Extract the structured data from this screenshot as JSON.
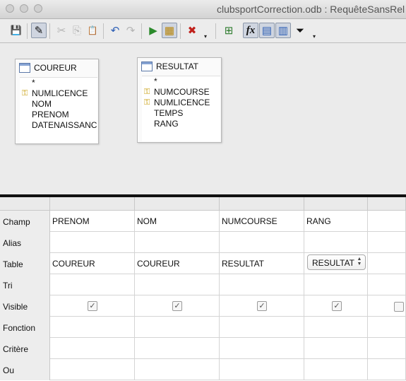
{
  "window": {
    "title": "clubsportCorrection.odb : RequêteSansRel"
  },
  "toolbar": {
    "buttons": [
      {
        "name": "save-icon",
        "glyph": "💾"
      },
      {
        "name": "edit-mode-icon",
        "glyph": "✎"
      },
      {
        "name": "cut-icon",
        "glyph": "✂"
      },
      {
        "name": "copy-icon",
        "glyph": "⎘"
      },
      {
        "name": "paste-icon",
        "glyph": "📋"
      },
      {
        "name": "undo-icon",
        "glyph": "↶"
      },
      {
        "name": "redo-icon",
        "glyph": "↷"
      },
      {
        "name": "run-query-icon",
        "glyph": "▶"
      },
      {
        "name": "clear-query-icon",
        "glyph": "▦"
      },
      {
        "name": "delete-icon",
        "glyph": "✖"
      },
      {
        "name": "add-table-icon",
        "glyph": "⊞"
      },
      {
        "name": "functions-icon",
        "glyph": "fx"
      },
      {
        "name": "table-names-icon",
        "glyph": "▤"
      },
      {
        "name": "alias-icon",
        "glyph": "▥"
      },
      {
        "name": "distinct-values-icon",
        "glyph": "⏷"
      }
    ],
    "more": "▾"
  },
  "tables": [
    {
      "name": "COUREUR",
      "fields": [
        {
          "label": "*",
          "key": false
        },
        {
          "label": "NUMLICENCE",
          "key": true
        },
        {
          "label": "NOM",
          "key": false
        },
        {
          "label": "PRENOM",
          "key": false
        },
        {
          "label": "DATENAISSANC",
          "key": false
        }
      ]
    },
    {
      "name": "RESULTAT",
      "fields": [
        {
          "label": "*",
          "key": false
        },
        {
          "label": "NUMCOURSE",
          "key": true
        },
        {
          "label": "NUMLICENCE",
          "key": true
        },
        {
          "label": "TEMPS",
          "key": false
        },
        {
          "label": "RANG",
          "key": false
        }
      ]
    }
  ],
  "grid": {
    "row_labels": [
      "Champ",
      "Alias",
      "Table",
      "Tri",
      "Visible",
      "Fonction",
      "Critère",
      "Ou"
    ],
    "columns": [
      {
        "champ": "PRENOM",
        "table": "COUREUR",
        "visible": true
      },
      {
        "champ": "NOM",
        "table": "COUREUR",
        "visible": true
      },
      {
        "champ": "NUMCOURSE",
        "table": "RESULTAT",
        "visible": true
      },
      {
        "champ": "RANG",
        "table": "RESULTAT",
        "visible": true
      }
    ],
    "check_glyph": "✓"
  }
}
